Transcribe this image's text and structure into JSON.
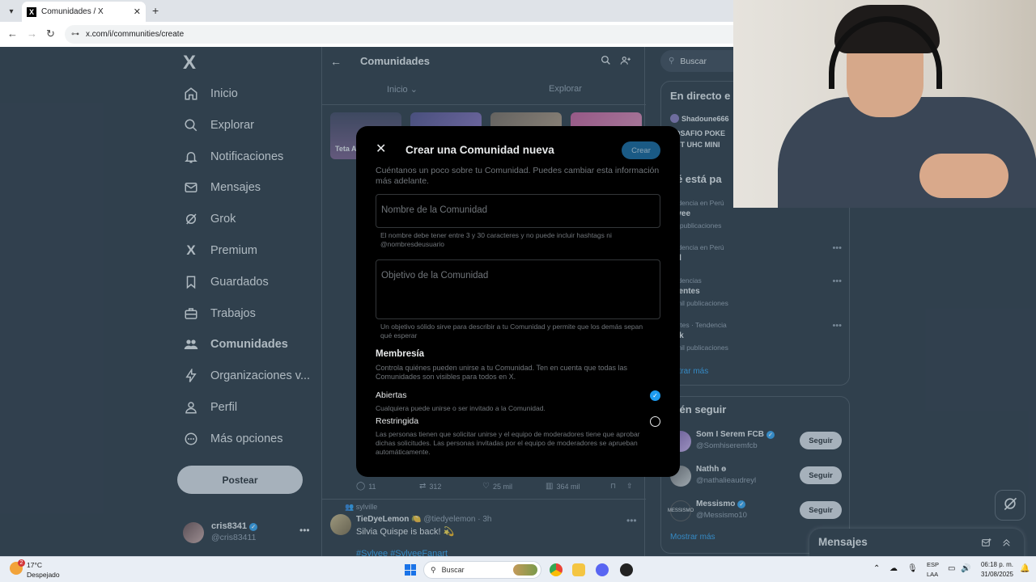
{
  "browser": {
    "tab_title": "Comunidades / X",
    "favicon": "X",
    "url": "x.com/i/communities/create"
  },
  "sidebar": {
    "logo": "X",
    "items": [
      {
        "label": "Inicio",
        "icon": "home-icon"
      },
      {
        "label": "Explorar",
        "icon": "search-icon"
      },
      {
        "label": "Notificaciones",
        "icon": "bell-icon"
      },
      {
        "label": "Mensajes",
        "icon": "mail-icon"
      },
      {
        "label": "Grok",
        "icon": "grok-icon"
      },
      {
        "label": "Premium",
        "icon": "x-logo-icon"
      },
      {
        "label": "Guardados",
        "icon": "bookmark-icon"
      },
      {
        "label": "Trabajos",
        "icon": "briefcase-icon"
      },
      {
        "label": "Comunidades",
        "icon": "communities-icon",
        "active": true
      },
      {
        "label": "Organizaciones v...",
        "icon": "lightning-icon"
      },
      {
        "label": "Perfil",
        "icon": "person-icon"
      },
      {
        "label": "Más opciones",
        "icon": "more-circle-icon"
      }
    ],
    "post_button": "Postear",
    "account": {
      "name": "cris8341",
      "handle": "@cris83411"
    }
  },
  "center": {
    "title": "Comunidades",
    "tabs": [
      "Inicio",
      "Explorar"
    ],
    "card_label": "Teta A",
    "feed_actions": {
      "replies": "11",
      "reposts": "312",
      "likes": "25 mil",
      "views": "364 mil"
    },
    "tweet": {
      "context": "sylville",
      "name": "TieDyeLemon",
      "handle": "@tiedyelemon",
      "time": "· 3h",
      "text": "Silvia Quispe is back! 💫",
      "hashtags": "#Sylvee #SylveeFanart"
    }
  },
  "right": {
    "search_placeholder": "Buscar",
    "live": {
      "title": "En directo e",
      "streamer": "Shadoune666",
      "line1": "EDSAFIO POKE",
      "line2": "AST UHC MINI"
    },
    "trends_title": "ué está pa",
    "trends": [
      {
        "context": "endencia en Perú",
        "name": "ylvee",
        "count": "80 publicaciones"
      },
      {
        "context": "endencia en Perú",
        "name": "sel",
        "count": ""
      },
      {
        "context": "endencias",
        "name": "rrientes",
        "count": "5 mil publicaciones"
      },
      {
        "context": "portes · Tendencia",
        "name": "ack",
        "count": "1 mil publicaciones"
      }
    ],
    "show_more_1": "ostrar más",
    "follow_title": "uién seguir",
    "follow": [
      {
        "name": "Som I Serem FCB",
        "handle": "@Somhiseremfcb",
        "button": "Seguir"
      },
      {
        "name": "Nathh ɵ",
        "handle": "@nathalieaudreyl",
        "button": "Seguir"
      },
      {
        "name": "Messismo",
        "handle": "@Messismo10",
        "button": "Seguir"
      }
    ],
    "show_more_2": "Mostrar más"
  },
  "messages_drawer": {
    "title": "Mensajes"
  },
  "modal": {
    "title": "Crear una Comunidad nueva",
    "create_button": "Crear",
    "intro": "Cuéntanos un poco sobre tu Comunidad. Puedes cambiar esta información más adelante.",
    "name_placeholder": "Nombre de la Comunidad",
    "name_hint": "El nombre debe tener entre 3 y 30 caracteres y no puede incluir hashtags ni @nombresdeusuario",
    "goal_placeholder": "Objetivo de la Comunidad",
    "goal_hint": "Un objetivo sólido sirve para describir a tu Comunidad y permite que los demás sepan qué esperar",
    "membership_title": "Membresía",
    "membership_desc": "Controla quiénes pueden unirse a tu Comunidad. Ten en cuenta que todas las Comunidades son visibles para todos en X.",
    "options": [
      {
        "label": "Abiertas",
        "desc": "Cualquiera puede unirse o ser invitado a la Comunidad.",
        "selected": true
      },
      {
        "label": "Restringida",
        "desc": "Las personas tienen que solicitar unirse y el equipo de moderadores tiene que aprobar dichas solicitudes. Las personas invitadas por el equipo de moderadores se aprueban automáticamente.",
        "selected": false
      }
    ]
  },
  "taskbar": {
    "weather_badge": "2",
    "temperature": "17°C",
    "weather": "Despejado",
    "search_placeholder": "Buscar",
    "lang_1": "ESP",
    "lang_2": "LAA",
    "time": "06:18 p. m.",
    "date": "31/08/2025"
  },
  "colors": {
    "accent": "#1d9bf0",
    "background": "#15202b",
    "modal": "#000000"
  }
}
